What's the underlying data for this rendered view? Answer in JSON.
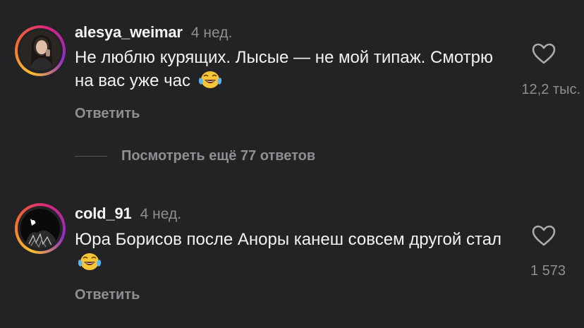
{
  "comments": [
    {
      "username": "alesya_weimar",
      "time": "4 нед.",
      "text": "Не люблю курящих. Лысые — не мой типаж. Смотрю на вас уже час",
      "emoji": "tears-of-joy",
      "reply_label": "Ответить",
      "likes": "12,2 тыс."
    },
    {
      "username": "cold_91",
      "time": "4 нед.",
      "text": "Юра Борисов после Аноры канеш совсем другой стал",
      "emoji": "tears-of-joy",
      "reply_label": "Ответить",
      "likes": "1 573"
    }
  ],
  "view_more_replies": "Посмотреть ещё 77 ответов",
  "colors": {
    "background": "#232325",
    "text": "#f2f2f2",
    "muted": "#8e8e93",
    "story_ring": [
      "#f9c02e",
      "#f56a2c",
      "#d8247f",
      "#8e2bc9"
    ]
  }
}
